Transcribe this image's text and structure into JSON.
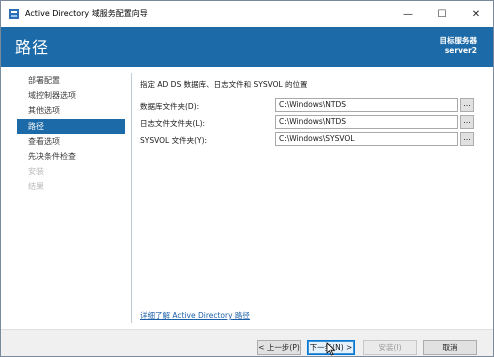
{
  "window": {
    "title": "Active Directory 域服务配置向导",
    "minimize_glyph": "—",
    "maximize_glyph": "☐",
    "close_glyph": "✕"
  },
  "header": {
    "page_title": "路径",
    "target_label": "目标服务器",
    "target_server": "server2"
  },
  "nav": {
    "items": [
      {
        "label": "部署配置",
        "state": "normal"
      },
      {
        "label": "域控制器选项",
        "state": "normal"
      },
      {
        "label": "其他选项",
        "state": "normal"
      },
      {
        "label": "路径",
        "state": "active"
      },
      {
        "label": "查看选项",
        "state": "normal"
      },
      {
        "label": "先决条件检查",
        "state": "normal"
      },
      {
        "label": "安装",
        "state": "disabled"
      },
      {
        "label": "结果",
        "state": "disabled"
      }
    ]
  },
  "content": {
    "description": "指定 AD DS 数据库、日志文件和 SYSVOL 的位置",
    "fields": [
      {
        "label": "数据库文件夹(D):",
        "value": "C:\\Windows\\NTDS"
      },
      {
        "label": "日志文件文件夹(L):",
        "value": "C:\\Windows\\NTDS"
      },
      {
        "label": "SYSVOL 文件夹(Y):",
        "value": "C:\\Windows\\SYSVOL"
      }
    ],
    "browse_label": "...",
    "learn_more": "详细了解 Active Directory 路径"
  },
  "footer": {
    "prev": "< 上一步(P)",
    "next": "下一步(N) >",
    "install": "安装(I)",
    "cancel": "取消"
  },
  "colors": {
    "accent": "#1c6aa8",
    "link": "#1c5fa8"
  }
}
